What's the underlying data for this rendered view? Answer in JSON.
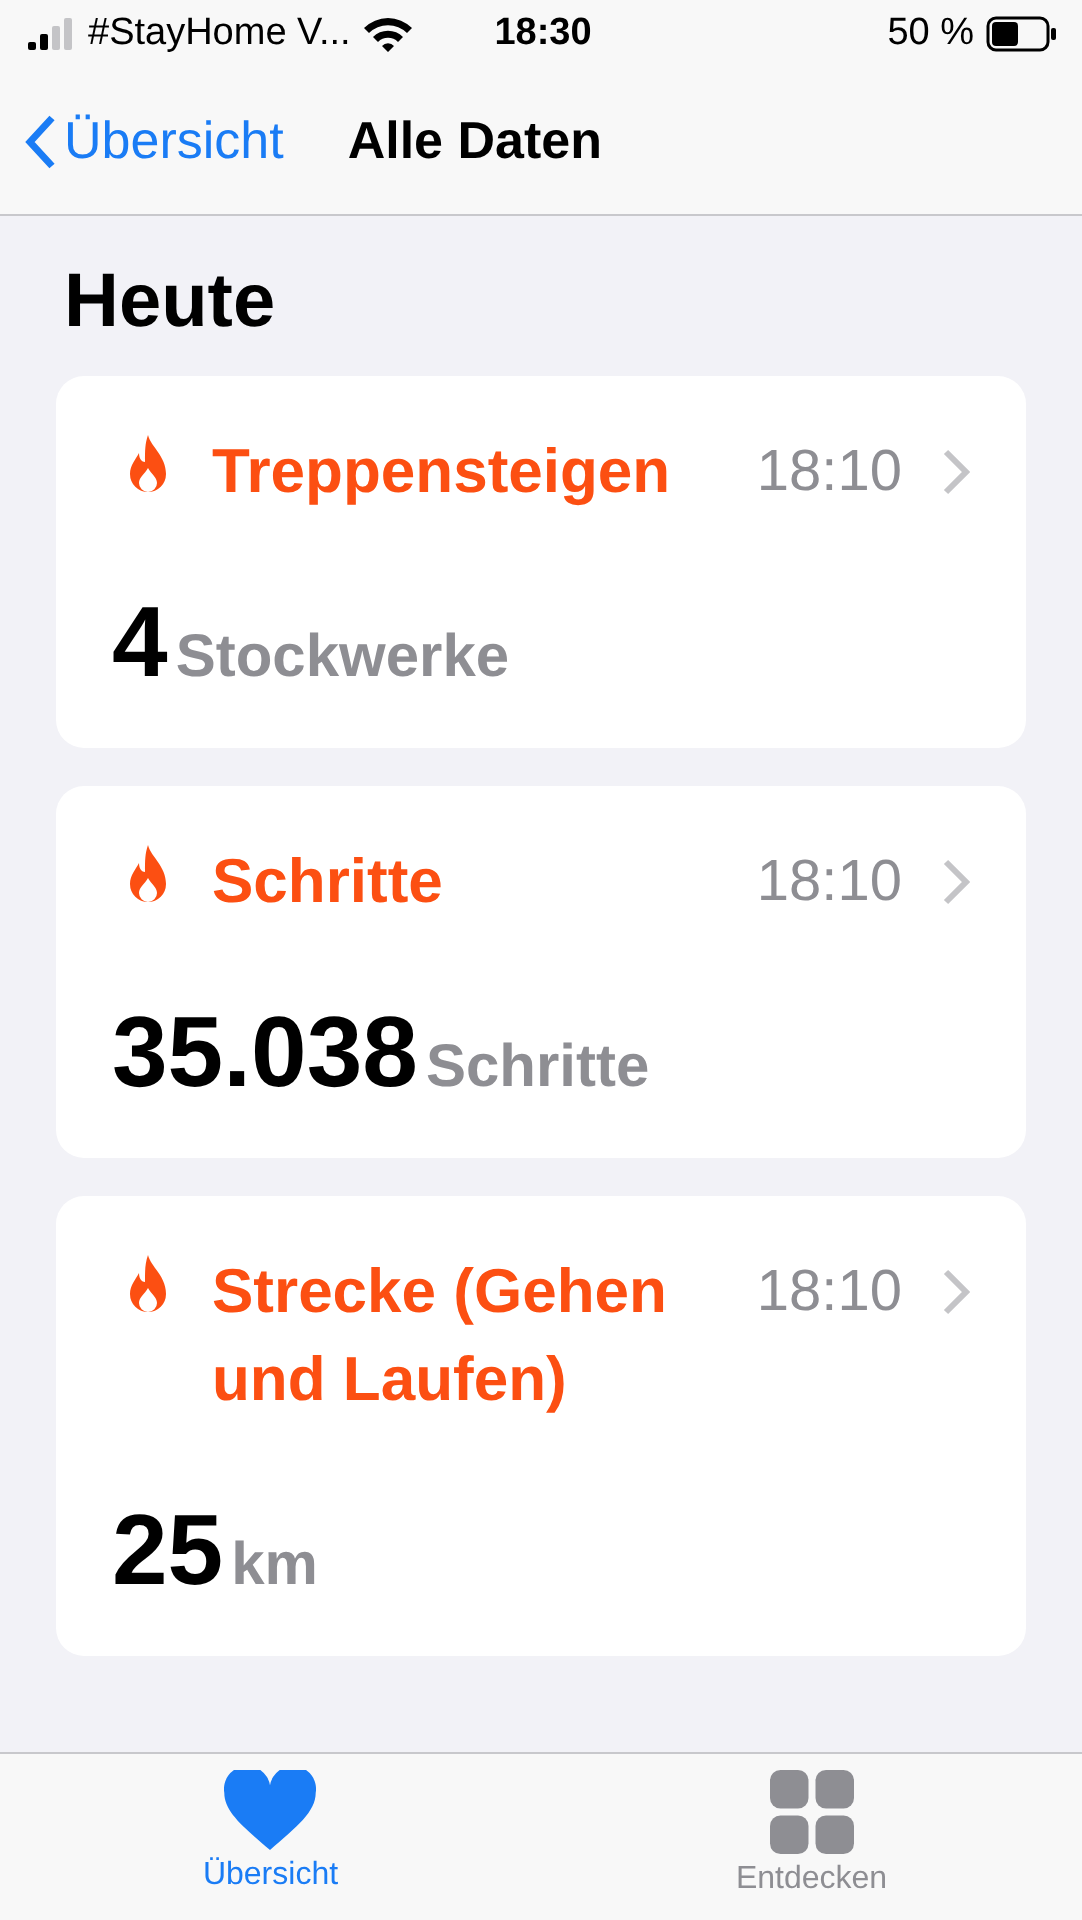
{
  "status_bar": {
    "carrier": "#StayHome V...",
    "time": "18:30",
    "battery": "50 %"
  },
  "nav": {
    "back": "Übersicht",
    "title": "Alle Daten"
  },
  "section_title": "Heute",
  "cards": [
    {
      "title": "Treppensteigen",
      "time": "18:10",
      "value": "4",
      "unit": "Stockwerke"
    },
    {
      "title": "Schritte",
      "time": "18:10",
      "value": "35.038",
      "unit": "Schritte"
    },
    {
      "title": "Strecke (Gehen und Laufen)",
      "time": "18:10",
      "value": "25",
      "unit": "km"
    }
  ],
  "tabs": [
    {
      "label": "Übersicht",
      "kind": "heart",
      "selected": true
    },
    {
      "label": "Entdecken",
      "kind": "grid",
      "selected": false
    }
  ]
}
